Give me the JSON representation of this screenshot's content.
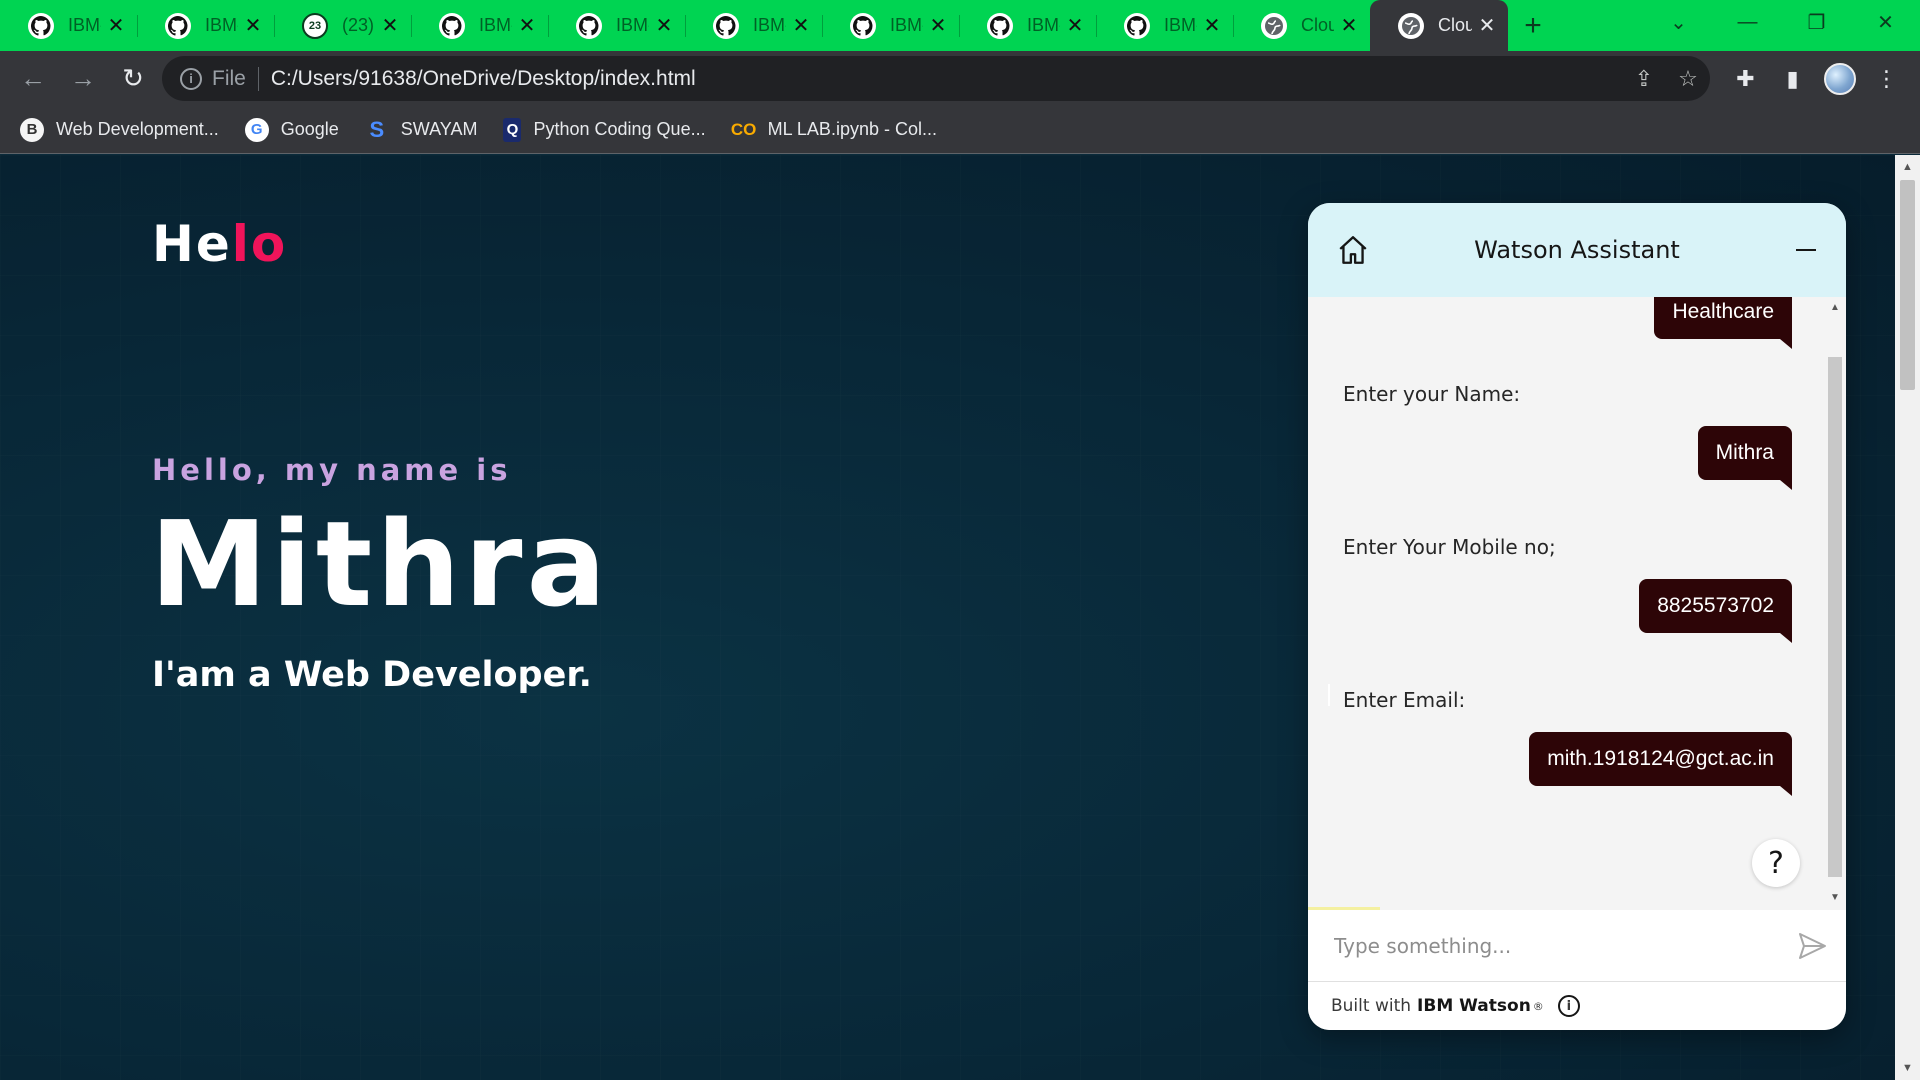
{
  "browser": {
    "tabs": [
      {
        "title": "IBM-",
        "icon": "github-icon"
      },
      {
        "title": "IBM-",
        "icon": "github-icon"
      },
      {
        "title": "(23) \\",
        "icon": "whatsapp-icon"
      },
      {
        "title": "IBM-",
        "icon": "github-icon"
      },
      {
        "title": "IBM-",
        "icon": "github-icon"
      },
      {
        "title": "IBM-",
        "icon": "github-icon"
      },
      {
        "title": "IBM-",
        "icon": "github-icon"
      },
      {
        "title": "IBM-",
        "icon": "github-icon"
      },
      {
        "title": "IBM-",
        "icon": "github-icon"
      },
      {
        "title": "Clou",
        "icon": "globe-icon"
      },
      {
        "title": "Clou",
        "icon": "globe-icon",
        "active": true
      }
    ],
    "address": {
      "scheme": "File",
      "url": "C:/Users/91638/OneDrive/Desktop/index.html"
    },
    "bookmarks": [
      {
        "label": "Web Development...",
        "icon": "bookmark-icon"
      },
      {
        "label": "Google",
        "icon": "google-icon"
      },
      {
        "label": "SWAYAM",
        "icon": "swayam-icon"
      },
      {
        "label": "Python Coding Que...",
        "icon": "python-icon"
      },
      {
        "label": "ML LAB.ipynb - Col...",
        "icon": "colab-icon"
      }
    ]
  },
  "site": {
    "logo_main": "He",
    "logo_accent": "lo",
    "greeting": "Hello, my name is",
    "name": "Mithra",
    "role": "I'am a Web Developer."
  },
  "watson": {
    "title": "Watson Assistant",
    "messages": [
      {
        "from": "user",
        "text": "Healthcare"
      },
      {
        "from": "bot",
        "text": "Enter your Name:"
      },
      {
        "from": "user",
        "text": "Mithra"
      },
      {
        "from": "bot",
        "text": "Enter Your Mobile no;"
      },
      {
        "from": "user",
        "text": "8825573702"
      },
      {
        "from": "bot",
        "text": "Enter Email:"
      },
      {
        "from": "user",
        "text": "mith.1918124@gct.ac.in"
      }
    ],
    "help_label": "?",
    "input_placeholder": "Type something...",
    "footer_prefix": "Built with",
    "footer_brand": "IBM Watson",
    "footer_reg": "®"
  },
  "colors": {
    "tabstrip": "#00d452",
    "logo_accent": "#f0145a",
    "user_bubble": "#2d0507",
    "watson_header": "#d9f3f8"
  }
}
